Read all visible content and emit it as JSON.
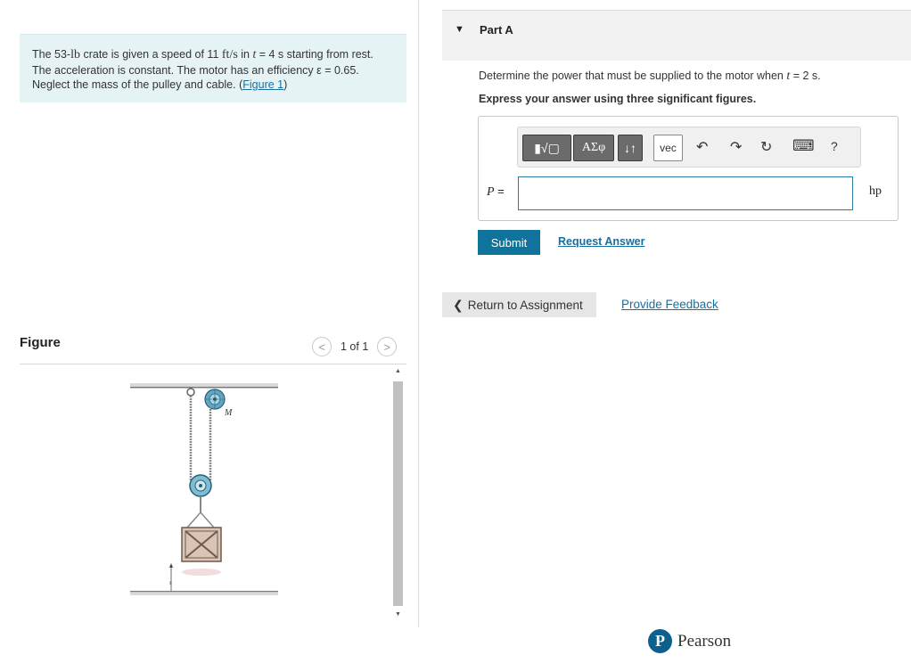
{
  "problem": {
    "text_1": "The 53-",
    "mass_unit": "lb",
    "text_2": " crate is given a speed of 11 ",
    "speed_unit": "ft/s",
    "text_3": " in ",
    "t_var": "t",
    "text_4": " = 4 s starting from rest. The acceleration is constant. The motor has an efficiency ε = 0.65. Neglect the mass of the pulley and cable. (",
    "figure_link": "Figure 1",
    "text_5": ")"
  },
  "figure": {
    "title": "Figure",
    "pager_text": "1 of 1",
    "prev_glyph": "<",
    "next_glyph": ">",
    "motor_label": "M",
    "distance_label": "s"
  },
  "part": {
    "caret": "▼",
    "title": "Part A",
    "question_pre": "Determine the power that must be supplied to the motor when ",
    "question_var": "t",
    "question_post": " = 2 s.",
    "instruction": "Express your answer using three significant figures.",
    "answer_label_var": "P",
    "answer_label_eq": " =",
    "answer_value": "",
    "unit": "hp",
    "toolbar": {
      "templates": "▮√▢",
      "greek": "ΑΣφ",
      "arrows": "↓↑",
      "vec": "vec",
      "undo": "↶",
      "redo": "↷",
      "reset": "↻",
      "keyboard": "⌨",
      "help": "?"
    },
    "submit": "Submit",
    "request_answer": "Request Answer"
  },
  "footer": {
    "return_chevron": "❮",
    "return_label": "Return to Assignment",
    "feedback": "Provide Feedback",
    "brand_letter": "P",
    "brand_name": "Pearson"
  }
}
